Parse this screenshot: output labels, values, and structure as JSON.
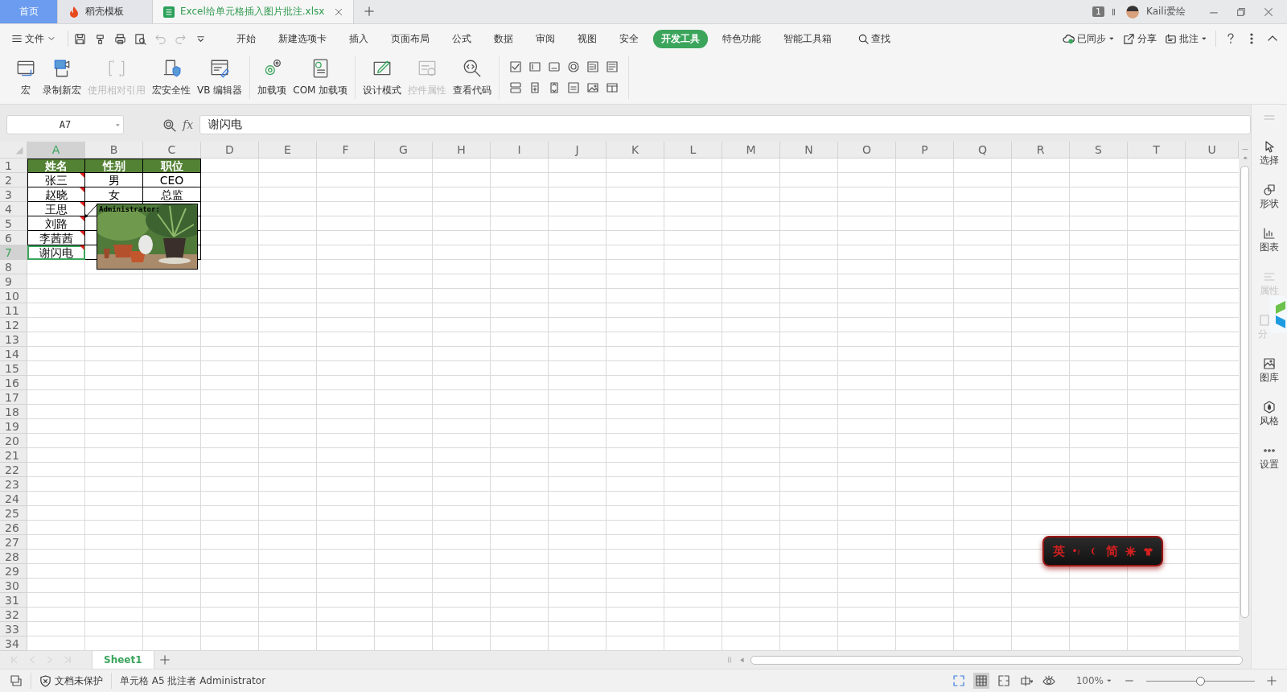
{
  "title_bar": {
    "tabs": [
      {
        "label": "首页",
        "kind": "home",
        "selected": false
      },
      {
        "label": "稻壳模板",
        "kind": "docer",
        "selected": false
      },
      {
        "label": "Excel给单元格插入图片批注.xlsx",
        "kind": "sheet",
        "selected": true
      }
    ],
    "window_count": "1",
    "user": "Kaili爱绘"
  },
  "menu_bar": {
    "file": "文件",
    "quick_access": [
      {
        "kind": "save",
        "disabled": false
      },
      {
        "kind": "painter",
        "disabled": false
      },
      {
        "kind": "print",
        "disabled": false
      },
      {
        "kind": "preview",
        "disabled": false
      },
      {
        "kind": "undo",
        "disabled": true
      },
      {
        "kind": "redo",
        "disabled": true
      },
      {
        "kind": "more",
        "disabled": false
      }
    ],
    "tabs": [
      {
        "label": "开始",
        "selected": false
      },
      {
        "label": "新建选项卡",
        "selected": false
      },
      {
        "label": "插入",
        "selected": false
      },
      {
        "label": "页面布局",
        "selected": false
      },
      {
        "label": "公式",
        "selected": false
      },
      {
        "label": "数据",
        "selected": false
      },
      {
        "label": "审阅",
        "selected": false
      },
      {
        "label": "视图",
        "selected": false
      },
      {
        "label": "安全",
        "selected": false
      },
      {
        "label": "开发工具",
        "selected": true
      },
      {
        "label": "特色功能",
        "selected": false
      },
      {
        "label": "智能工具箱",
        "selected": false
      }
    ],
    "search": "查找",
    "actions": [
      {
        "label": "已同步",
        "kind": "sync",
        "dropdown": true
      },
      {
        "label": "分享",
        "kind": "share",
        "dropdown": false
      },
      {
        "label": "批注",
        "kind": "comment",
        "dropdown": true
      }
    ]
  },
  "ribbon": {
    "groups": [
      [
        {
          "label": "宏",
          "kind": "macro",
          "disabled": false
        },
        {
          "label": "录制新宏",
          "kind": "record",
          "disabled": false
        },
        {
          "label": "使用相对引用",
          "kind": "relative",
          "disabled": true
        },
        {
          "label": "宏安全性",
          "kind": "security",
          "disabled": false
        },
        {
          "label": "VB 编辑器",
          "kind": "vb",
          "disabled": false
        }
      ],
      [
        {
          "label": "加载项",
          "kind": "addin",
          "disabled": false
        },
        {
          "label": "COM 加载项",
          "kind": "com",
          "disabled": false
        }
      ],
      [
        {
          "label": "设计模式",
          "kind": "design",
          "disabled": false
        },
        {
          "label": "控件属性",
          "kind": "props",
          "disabled": true
        },
        {
          "label": "查看代码",
          "kind": "code",
          "disabled": false
        }
      ]
    ]
  },
  "formula_bar": {
    "name_box": "A7",
    "fx": "fx",
    "value": "谢闪电"
  },
  "sheet": {
    "columns": [
      {
        "label": "A",
        "selected": true
      },
      {
        "label": "B",
        "selected": false
      },
      {
        "label": "C",
        "selected": false
      },
      {
        "label": "D",
        "selected": false
      },
      {
        "label": "E",
        "selected": false
      },
      {
        "label": "F",
        "selected": false
      },
      {
        "label": "G",
        "selected": false
      },
      {
        "label": "H",
        "selected": false
      },
      {
        "label": "I",
        "selected": false
      },
      {
        "label": "J",
        "selected": false
      },
      {
        "label": "K",
        "selected": false
      },
      {
        "label": "L",
        "selected": false
      },
      {
        "label": "M",
        "selected": false
      },
      {
        "label": "N",
        "selected": false
      },
      {
        "label": "O",
        "selected": false
      },
      {
        "label": "P",
        "selected": false
      },
      {
        "label": "Q",
        "selected": false
      },
      {
        "label": "R",
        "selected": false
      },
      {
        "label": "S",
        "selected": false
      },
      {
        "label": "T",
        "selected": false
      },
      {
        "label": "U",
        "selected": false
      }
    ],
    "row_headers": [
      {
        "label": "1",
        "selected": false
      },
      {
        "label": "2",
        "selected": false
      },
      {
        "label": "3",
        "selected": false
      },
      {
        "label": "4",
        "selected": false
      },
      {
        "label": "5",
        "selected": false
      },
      {
        "label": "6",
        "selected": false
      },
      {
        "label": "7",
        "selected": true
      },
      {
        "label": "8",
        "selected": false
      },
      {
        "label": "9",
        "selected": false
      },
      {
        "label": "10",
        "selected": false
      },
      {
        "label": "11",
        "selected": false
      },
      {
        "label": "12",
        "selected": false
      },
      {
        "label": "13",
        "selected": false
      },
      {
        "label": "14",
        "selected": false
      },
      {
        "label": "15",
        "selected": false
      },
      {
        "label": "16",
        "selected": false
      },
      {
        "label": "17",
        "selected": false
      },
      {
        "label": "18",
        "selected": false
      },
      {
        "label": "19",
        "selected": false
      },
      {
        "label": "20",
        "selected": false
      },
      {
        "label": "21",
        "selected": false
      },
      {
        "label": "22",
        "selected": false
      },
      {
        "label": "23",
        "selected": false
      },
      {
        "label": "24",
        "selected": false
      },
      {
        "label": "25",
        "selected": false
      },
      {
        "label": "26",
        "selected": false
      },
      {
        "label": "27",
        "selected": false
      },
      {
        "label": "28",
        "selected": false
      },
      {
        "label": "29",
        "selected": false
      },
      {
        "label": "30",
        "selected": false
      },
      {
        "label": "31",
        "selected": false
      },
      {
        "label": "32",
        "selected": false
      },
      {
        "label": "33",
        "selected": false
      },
      {
        "label": "34",
        "selected": false
      }
    ],
    "rows": [
      {
        "kind": "header",
        "cells": [
          {
            "text": "姓名",
            "comment": false,
            "selected": false
          },
          {
            "text": "性别",
            "comment": false,
            "selected": false
          },
          {
            "text": "职位",
            "comment": false,
            "selected": false
          }
        ]
      },
      {
        "kind": "data",
        "cells": [
          {
            "text": "张三",
            "comment": true,
            "selected": false
          },
          {
            "text": "男",
            "comment": false,
            "selected": false
          },
          {
            "text": "CEO",
            "comment": false,
            "selected": false
          }
        ]
      },
      {
        "kind": "data",
        "cells": [
          {
            "text": "赵晓",
            "comment": true,
            "selected": false
          },
          {
            "text": "女",
            "comment": false,
            "selected": false
          },
          {
            "text": "总监",
            "comment": false,
            "selected": false
          }
        ]
      },
      {
        "kind": "data",
        "cells": [
          {
            "text": "王思",
            "comment": true,
            "selected": false
          }
        ]
      },
      {
        "kind": "data",
        "cells": [
          {
            "text": "刘路",
            "comment": true,
            "selected": false
          }
        ]
      },
      {
        "kind": "data",
        "cells": [
          {
            "text": "李茜茜",
            "comment": true,
            "selected": false
          }
        ]
      },
      {
        "kind": "data",
        "cells": [
          {
            "text": "谢闪电",
            "comment": true,
            "selected": true
          }
        ]
      }
    ],
    "comment": {
      "author": "Administrator:",
      "kind": "picture"
    }
  },
  "sheet_tabs": [
    {
      "label": "Sheet1",
      "selected": true
    }
  ],
  "side_panel": [
    {
      "label": "选择",
      "kind": "select",
      "disabled": false
    },
    {
      "label": "形状",
      "kind": "shape",
      "disabled": false
    },
    {
      "label": "图表",
      "kind": "chart",
      "disabled": false
    },
    {
      "label": "属性",
      "kind": "property",
      "disabled": true
    },
    {
      "label": "分",
      "kind": "analysis",
      "disabled": true
    },
    {
      "label": "图库",
      "kind": "gallery",
      "disabled": false
    },
    {
      "label": "风格",
      "kind": "style",
      "disabled": false
    },
    {
      "label": "设置",
      "kind": "settings",
      "disabled": false
    }
  ],
  "ime_bar": {
    "language": "英",
    "script": "简"
  },
  "status_bar": {
    "protection": "文档未保护",
    "message": "单元格 A5 批注者 Administrator",
    "views": [
      {
        "kind": "fullscreen",
        "selected": false
      },
      {
        "kind": "normal",
        "selected": true
      },
      {
        "kind": "page_break",
        "selected": false
      },
      {
        "kind": "reading",
        "selected": false
      },
      {
        "kind": "eye",
        "selected": false
      }
    ],
    "zoom": "100%",
    "zoom_slider": {
      "level": 0.5
    }
  }
}
